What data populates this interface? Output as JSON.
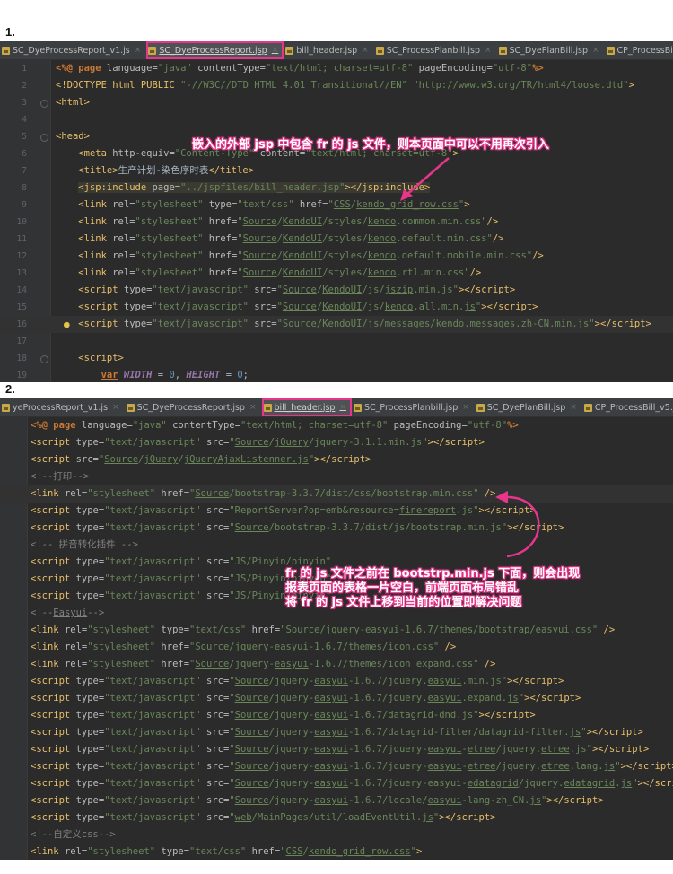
{
  "sections": [
    "1.",
    "2."
  ],
  "panel1": {
    "tabs": [
      {
        "label": "SC_DyeProcessReport_v1.js",
        "active": false,
        "highlight": false
      },
      {
        "label": "SC_DyeProcessReport.jsp",
        "active": true,
        "highlight": true
      },
      {
        "label": "bill_header.jsp",
        "active": false,
        "highlight": false
      },
      {
        "label": "SC_ProcessPlanbill.jsp",
        "active": false,
        "highlight": false
      },
      {
        "label": "SC_DyePlanBill.jsp",
        "active": false,
        "highlight": false
      },
      {
        "label": "CP_ProcessBill",
        "active": false,
        "highlight": false
      }
    ],
    "line_numbers": [
      "1",
      "2",
      "3",
      "4",
      "5",
      "6",
      "7",
      "8",
      "9",
      "10",
      "11",
      "12",
      "13",
      "14",
      "15",
      "16",
      "17",
      "18",
      "19",
      "20",
      "21",
      "22"
    ],
    "annotation": "嵌入的外部 jsp 中包含 fr 的 js 文件，则本页面中可以不用再次引入"
  },
  "panel2": {
    "tabs": [
      {
        "label": "yeProcessReport_v1.js",
        "active": false,
        "highlight": false
      },
      {
        "label": "SC_DyeProcessReport.jsp",
        "active": false,
        "highlight": false
      },
      {
        "label": "bill_header.jsp",
        "active": true,
        "highlight": true
      },
      {
        "label": "SC_ProcessPlanbill.jsp",
        "active": false,
        "highlight": false
      },
      {
        "label": "SC_DyePlanBill.jsp",
        "active": false,
        "highlight": false
      },
      {
        "label": "CP_ProcessBill_v5.js",
        "active": false,
        "highlight": false
      }
    ],
    "annotation_lines": [
      "fr 的 js 文件之前在 bootstrp.min.js 下面，则会出现",
      "报表页面的表格一片空白，前端页面布局错乱",
      "将 fr 的 js 文件上移到当前的位置即解决问题"
    ]
  },
  "colors": {
    "annotation": "#e6358a",
    "editor_bg": "#2b2b2b",
    "tag": "#e8bf6a",
    "string": "#6a8759",
    "keyword": "#cc7832"
  }
}
